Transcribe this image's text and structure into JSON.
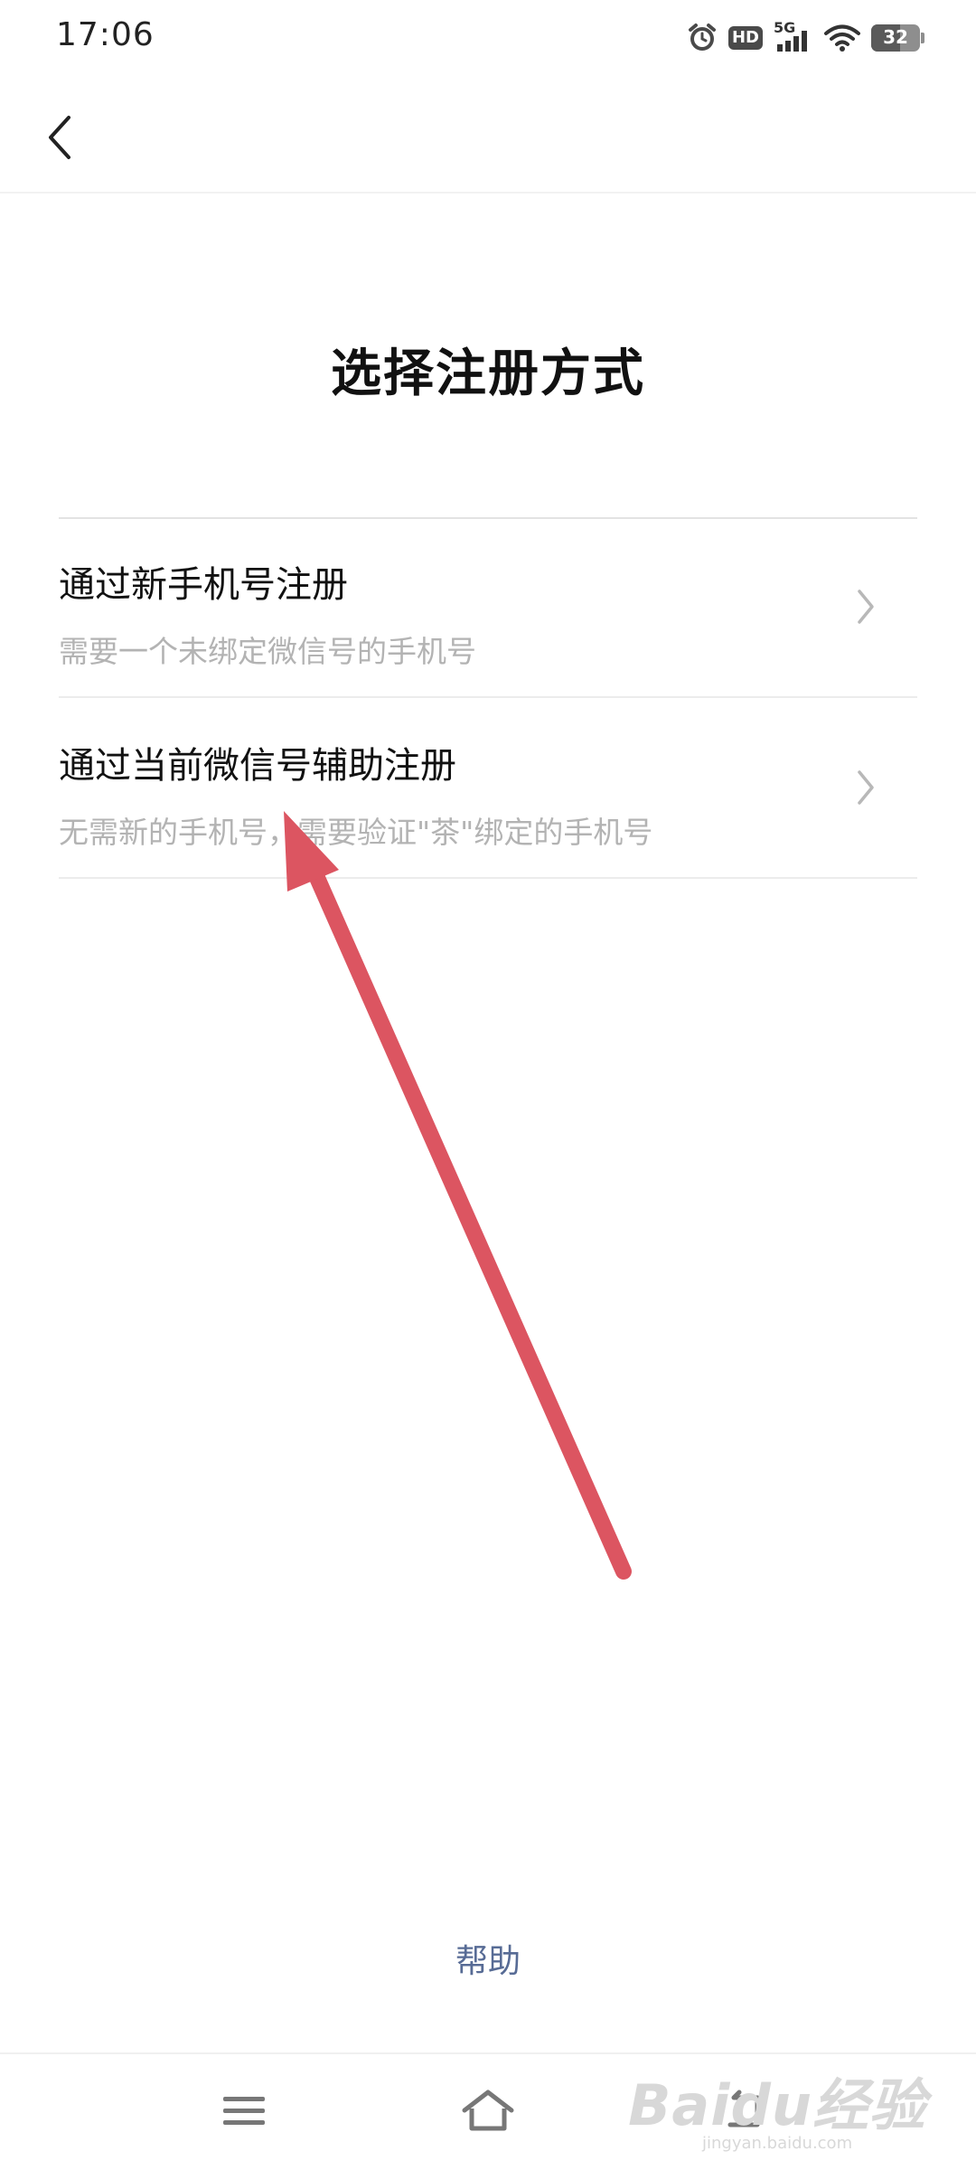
{
  "status_bar": {
    "time": "17:06",
    "network": "5G",
    "hd_label": "HD",
    "battery": "32"
  },
  "header": {
    "title": "选择注册方式"
  },
  "options": [
    {
      "title": "通过新手机号注册",
      "description": "需要一个未绑定微信号的手机号"
    },
    {
      "title": "通过当前微信号辅助注册",
      "description": "无需新的手机号，需要验证\"茶\"绑定的手机号"
    }
  ],
  "footer": {
    "help_label": "帮助"
  },
  "watermark": {
    "logo": "Baidu经验",
    "url": "jingyan.baidu.com"
  },
  "colors": {
    "link": "#576b95",
    "annotation_arrow": "#dc5561"
  }
}
